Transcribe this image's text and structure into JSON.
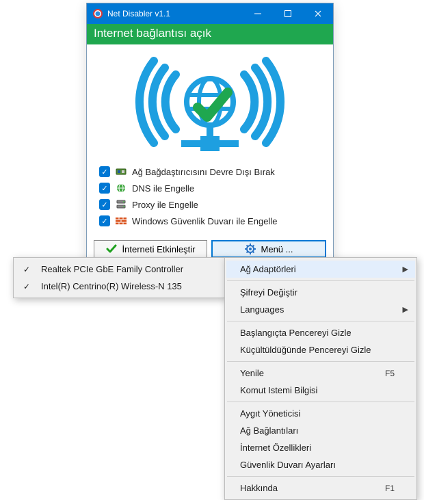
{
  "titlebar": {
    "app_title": "Net Disabler v1.1"
  },
  "status": {
    "text": "Internet bağlantısı açık"
  },
  "options": {
    "items": [
      {
        "label": "Ağ Bağdaştırıcısını Devre Dışı Bırak"
      },
      {
        "label": "DNS ile Engelle"
      },
      {
        "label": "Proxy ile Engelle"
      },
      {
        "label": "Windows Güvenlik Duvarı ile Engelle"
      }
    ]
  },
  "buttons": {
    "enable_internet": "İnterneti Etkinleştir",
    "menu": "Menü ..."
  },
  "menu": {
    "adapters": "Ağ Adaptörleri",
    "change_password": "Şifreyi Değiştir",
    "languages": "Languages",
    "hide_on_start": "Başlangıçta Pencereyi Gizle",
    "hide_on_minimize": "Küçültüldüğünde Pencereyi Gizle",
    "refresh": "Yenile",
    "refresh_sc": "F5",
    "cmd_info": "Komut Istemi Bilgisi",
    "device_manager": "Aygıt Yöneticisi",
    "net_connections": "Ağ Bağlantıları",
    "inet_props": "İnternet Özellikleri",
    "firewall_settings": "Güvenlik Duvarı Ayarları",
    "about": "Hakkında",
    "about_sc": "F1"
  },
  "adapters": {
    "items": [
      "Realtek PCIe GbE Family Controller",
      "Intel(R) Centrino(R) Wireless-N 135"
    ]
  }
}
